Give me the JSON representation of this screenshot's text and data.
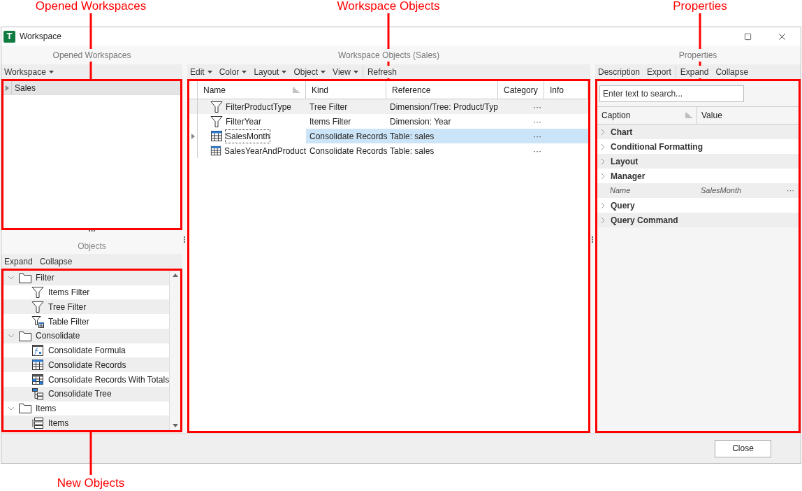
{
  "callouts": [
    {
      "label": "Opened Workspaces"
    },
    {
      "label": "Workspace Objects"
    },
    {
      "label": "Properties"
    },
    {
      "label": "New Objects"
    }
  ],
  "window": {
    "app_icon_letter": "T",
    "title": "Workspace"
  },
  "opened_workspaces": {
    "title": "Opened Workspaces",
    "toolbar": [
      {
        "items": [
          {
            "label": "Workspace",
            "dropdown": true
          }
        ]
      }
    ],
    "items": [
      {
        "label": "Sales",
        "selected": true,
        "expanded": false
      }
    ]
  },
  "objects": {
    "title": "Objects",
    "toolbar": [
      {
        "items": [
          {
            "label": "Expand",
            "dropdown": false
          },
          {
            "label": "Collapse",
            "dropdown": false
          }
        ]
      }
    ],
    "groups": [
      {
        "label": "Filter",
        "expanded": true,
        "children": [
          {
            "label": "Items Filter",
            "kind": "funnel"
          },
          {
            "label": "Tree Filter",
            "kind": "funnel"
          },
          {
            "label": "Table Filter",
            "kind": "table-funnel"
          }
        ]
      },
      {
        "label": "Consolidate",
        "expanded": true,
        "children": [
          {
            "label": "Consolidate Formula",
            "kind": "formula"
          },
          {
            "label": "Consolidate Records",
            "kind": "records"
          },
          {
            "label": "Consolidate Records With Totals",
            "kind": "totals"
          },
          {
            "label": "Consolidate Tree",
            "kind": "tree"
          }
        ]
      },
      {
        "label": "Items",
        "expanded": true,
        "children": [
          {
            "label": "Items",
            "kind": "items"
          }
        ]
      }
    ]
  },
  "workspace_objects": {
    "title": "Workspace Objects (Sales)",
    "toolbar": [
      {
        "items": [
          {
            "label": "Edit",
            "dropdown": true
          },
          {
            "label": "Color",
            "dropdown": true
          },
          {
            "label": "Layout",
            "dropdown": true
          },
          {
            "label": "Object",
            "dropdown": true
          },
          {
            "label": "View",
            "dropdown": true
          }
        ]
      },
      {
        "items": [
          {
            "label": "Refresh",
            "dropdown": false
          }
        ]
      }
    ],
    "columns": [
      {
        "label": "Name",
        "sortable": true
      },
      {
        "label": "Kind"
      },
      {
        "label": "Reference"
      },
      {
        "label": "Category"
      },
      {
        "label": "Info"
      }
    ],
    "rows": [
      {
        "kind": "funnel",
        "name": "FilterProductType",
        "type": "Tree Filter",
        "reference": "Dimension/Tree: Product/Typ",
        "category": "···",
        "selected": false
      },
      {
        "kind": "funnel",
        "name": "FilterYear",
        "type": "Items Filter",
        "reference": "Dimension: Year",
        "category": "···",
        "selected": false
      },
      {
        "kind": "records",
        "name": "SalesMonth",
        "type": "Consolidate Records",
        "reference": "Table: sales",
        "category": "···",
        "selected": true
      },
      {
        "kind": "records",
        "name": "SalesYearAndProduct",
        "type": "Consolidate Records",
        "reference": "Table: sales",
        "category": "···",
        "selected": false
      }
    ]
  },
  "properties": {
    "title": "Properties",
    "toolbar": [
      {
        "items": [
          {
            "label": "Description",
            "dropdown": false
          },
          {
            "label": "Export",
            "dropdown": false
          }
        ]
      },
      {
        "items": [
          {
            "label": "Expand",
            "dropdown": false
          },
          {
            "label": "Collapse",
            "dropdown": false
          }
        ]
      }
    ],
    "search": {
      "placeholder": "Enter text to search..."
    },
    "columns": [
      {
        "label": "Caption",
        "sortable": true
      },
      {
        "label": "Value"
      }
    ],
    "rows": [
      {
        "kind": "category",
        "label": "Chart"
      },
      {
        "kind": "category",
        "label": "Conditional Formatting"
      },
      {
        "kind": "category",
        "label": "Layout"
      },
      {
        "kind": "category",
        "label": "Manager"
      },
      {
        "kind": "property",
        "label": "Name",
        "value": "SalesMonth",
        "more": "···"
      },
      {
        "kind": "category",
        "label": "Query"
      },
      {
        "kind": "category",
        "label": "Query Command"
      }
    ]
  },
  "buttons": [
    {
      "label": "Close"
    }
  ]
}
